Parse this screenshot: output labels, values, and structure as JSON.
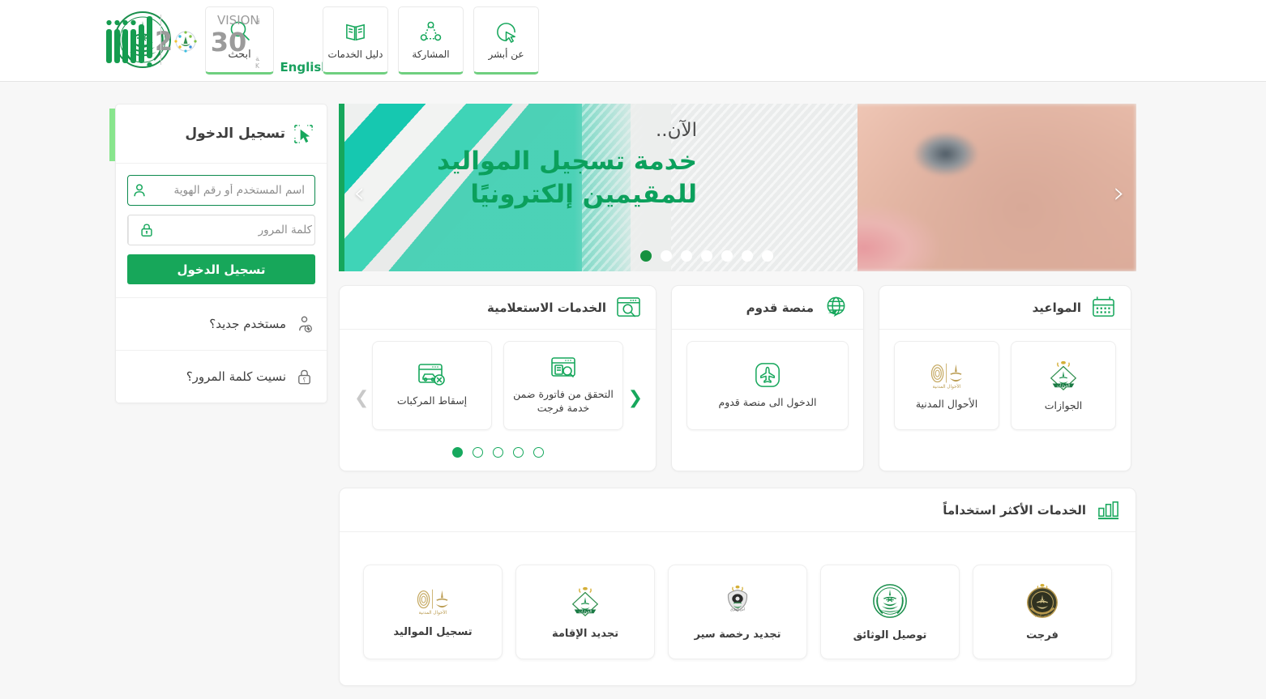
{
  "colors": {
    "brand_green": "#17a75a",
    "accent_light_green": "#88e58d",
    "hero_green": "#0ba05c",
    "teal": "#3ecfb2",
    "page_bg": "#f7f7f7"
  },
  "header": {
    "moi_logo_name": "ministry-of-interior-emblem",
    "search": {
      "label": "ابحث",
      "icon": "search-icon"
    },
    "language_toggle": "English",
    "nav_items": [
      {
        "label": "دليل الخدمات",
        "icon": "book-icon"
      },
      {
        "label": "المشاركة",
        "icon": "share-network-icon"
      },
      {
        "label": "عن أبشر",
        "icon": "cursor-circle-icon"
      }
    ],
    "vision_logo": {
      "vision_word": "VISION",
      "vision_word_ar": "رؤيــــة",
      "year": "2030",
      "kingdom_ar": "المملكة العربية السعودية",
      "kingdom_en": "KINGDOM OF SAUDI ARABIA"
    },
    "absher_logo_name": "absher-wordmark"
  },
  "hero": {
    "kicker": "الآن..",
    "line1": "خدمة تسجيل المواليد",
    "line2": "للمقيمين إلكترونيًا",
    "prev_arrow": "‹",
    "next_arrow": "›",
    "dots_total": 7,
    "dot_active_index": 6
  },
  "cards": [
    {
      "id": "inquiry-services",
      "title": "الخدمات الاستعلامية",
      "icon": "browser-search-icon",
      "tiles": [
        {
          "label": "إسقاط المركبات",
          "icon": "browser-car-remove-icon"
        },
        {
          "label": "التحقق من فاتورة ضمن خدمة فرجت",
          "icon": "document-search-icon"
        }
      ],
      "prev_arrow": "❮",
      "next_arrow": "❯",
      "dots_total": 5,
      "dot_active_index": 0
    },
    {
      "id": "qudum-platform",
      "title": "منصة قدوم",
      "icon": "globe-plane-icon",
      "tiles": [
        {
          "label": "الدخول الى منصة قدوم",
          "icon": "airplane-rounded-icon"
        }
      ]
    },
    {
      "id": "appointments",
      "title": "المواعيد",
      "icon": "calendar-icon",
      "tiles": [
        {
          "label": "الأحوال المدنية",
          "icon": "civil-affairs-emblem"
        },
        {
          "label": "الجوازات",
          "icon": "passports-emblem"
        }
      ]
    }
  ],
  "most_used": {
    "title": "الخدمات الأكثر استخداماً",
    "icon": "bar-chart-icon",
    "tiles": [
      {
        "label": "تسجيل المواليد",
        "icon": "civil-affairs-emblem"
      },
      {
        "label": "تجديد الإقامة",
        "icon": "passports-emblem"
      },
      {
        "label": "تجديد رخصة سير",
        "icon": "traffic-police-emblem"
      },
      {
        "label": "توصيل الوثائق",
        "icon": "ministry-of-interior-emblem"
      },
      {
        "label": "فرجت",
        "icon": "public-security-emblem"
      }
    ]
  },
  "login": {
    "title": "تسجيل الدخول",
    "title_icon": "cursor-select-icon",
    "username": {
      "placeholder": "اسم المستخدم أو رقم الهوية",
      "value": "",
      "icon": "user-icon",
      "focused": true
    },
    "password": {
      "placeholder": "كلمة المرور",
      "value": "",
      "icon": "lock-icon"
    },
    "submit_label": "تسجيل الدخول",
    "new_user": {
      "label": "مستخدم جديد؟",
      "icon": "user-add-icon"
    },
    "forgot_password": {
      "label": "نسيت كلمة المرور؟",
      "icon": "lock-question-icon"
    }
  }
}
